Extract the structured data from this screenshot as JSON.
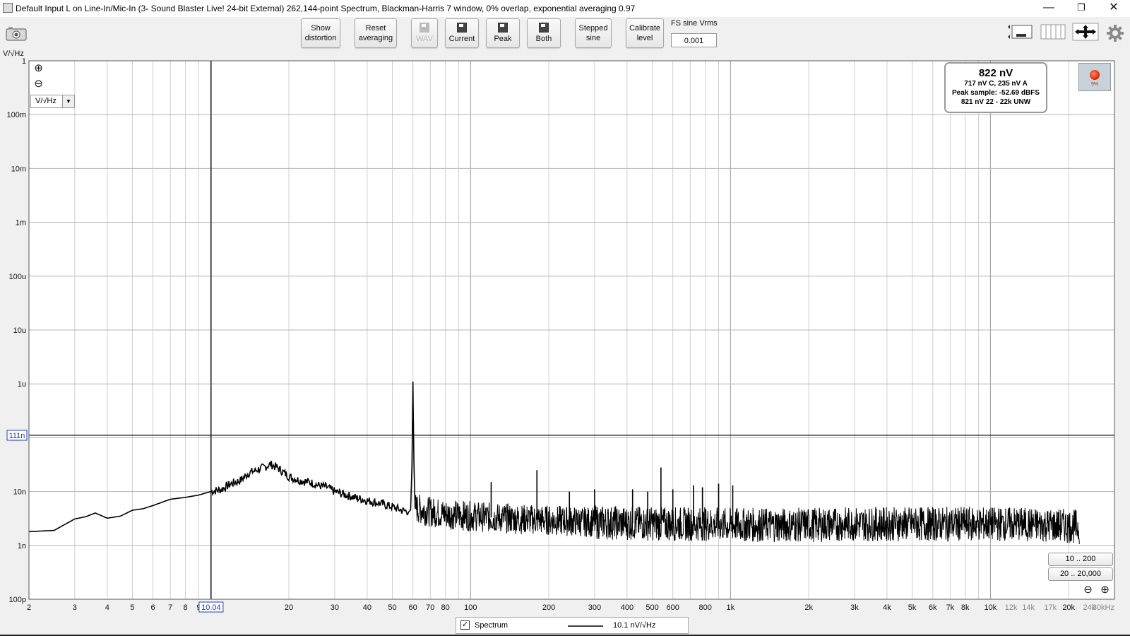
{
  "window": {
    "title": "Default Input L on Line-In/Mic-In (3- Sound Blaster Live! 24-bit External) 262,144-point Spectrum, Blackman-Harris 7 window, 0% overlap, exponential averaging 0.97",
    "minimize": "—",
    "restore": "❐",
    "close": "✕"
  },
  "toolbar": {
    "show_distortion_1": "Show",
    "show_distortion_2": "distortion",
    "reset_averaging_1": "Reset",
    "reset_averaging_2": "averaging",
    "wav": "WAV",
    "current": "Current",
    "peak": "Peak",
    "both": "Both",
    "stepped_sine_1": "Stepped",
    "stepped_sine_2": "sine",
    "calibrate_level_1": "Calibrate",
    "calibrate_level_2": "level",
    "fs_label": "FS sine Vrms",
    "fs_value": "0.001",
    "icons": [
      "camera-icon",
      "view-layout-icon",
      "columns-icon",
      "fit-arrows-icon",
      "gear-icon"
    ]
  },
  "readout": {
    "main": "822 nV",
    "line1": "717 nV C, 235 nV A",
    "line2": "Peak sample: -52.69 dBFS",
    "line3": "821 nV 22 - 22k UNW"
  },
  "record_button": {
    "percent": "9%",
    "color": "#e03010"
  },
  "unit_select": {
    "value": "V/√Hz"
  },
  "range_buttons": {
    "r1": "10 .. 200",
    "r2": "20 .. 20,000"
  },
  "legend": {
    "checked": true,
    "check_mark": "✓",
    "label": "Spectrum",
    "value": "10.1 nV/√Hz"
  },
  "cursor": {
    "x_label": "10.04",
    "y_label": "111n"
  },
  "chart_data": {
    "type": "line",
    "ylabel": "V/√Hz",
    "xlabel_unit": "kHz",
    "x_scale": "log",
    "y_scale": "log",
    "xlim": [
      2,
      30000
    ],
    "ylim": [
      1e-10,
      1
    ],
    "grid": true,
    "y_ticks": [
      {
        "v": 1,
        "t": "1"
      },
      {
        "v": 0.1,
        "t": "100m"
      },
      {
        "v": 0.01,
        "t": "10m"
      },
      {
        "v": 0.001,
        "t": "1m"
      },
      {
        "v": 0.0001,
        "t": "100u"
      },
      {
        "v": 1e-05,
        "t": "10u"
      },
      {
        "v": 1e-06,
        "t": "1u"
      },
      {
        "v": 1e-07,
        "t": "111n"
      },
      {
        "v": 1e-08,
        "t": "10n"
      },
      {
        "v": 1e-09,
        "t": "1n"
      },
      {
        "v": 1e-10,
        "t": "100p"
      }
    ],
    "x_ticks": [
      {
        "v": 2,
        "t": "2"
      },
      {
        "v": 3,
        "t": "3"
      },
      {
        "v": 4,
        "t": "4"
      },
      {
        "v": 5,
        "t": "5"
      },
      {
        "v": 6,
        "t": "6"
      },
      {
        "v": 7,
        "t": "7"
      },
      {
        "v": 8,
        "t": "8"
      },
      {
        "v": 9,
        "t": "9"
      },
      {
        "v": 20,
        "t": "20"
      },
      {
        "v": 30,
        "t": "30"
      },
      {
        "v": 40,
        "t": "40"
      },
      {
        "v": 50,
        "t": "50"
      },
      {
        "v": 60,
        "t": "60"
      },
      {
        "v": 70,
        "t": "70"
      },
      {
        "v": 80,
        "t": "80"
      },
      {
        "v": 100,
        "t": "100"
      },
      {
        "v": 200,
        "t": "200"
      },
      {
        "v": 300,
        "t": "300"
      },
      {
        "v": 400,
        "t": "400"
      },
      {
        "v": 500,
        "t": "500"
      },
      {
        "v": 600,
        "t": "600"
      },
      {
        "v": 800,
        "t": "800"
      },
      {
        "v": 1000,
        "t": "1k"
      },
      {
        "v": 2000,
        "t": "2k"
      },
      {
        "v": 3000,
        "t": "3k"
      },
      {
        "v": 4000,
        "t": "4k"
      },
      {
        "v": 5000,
        "t": "5k"
      },
      {
        "v": 6000,
        "t": "6k"
      },
      {
        "v": 7000,
        "t": "7k"
      },
      {
        "v": 8000,
        "t": "8k"
      },
      {
        "v": 10000,
        "t": "10k"
      },
      {
        "v": 12000,
        "t": "12k"
      },
      {
        "v": 14000,
        "t": "14k"
      },
      {
        "v": 17000,
        "t": "17k"
      },
      {
        "v": 20000,
        "t": "20k"
      },
      {
        "v": 24000,
        "t": "24k"
      },
      {
        "v": 30000,
        "t": "30kHz"
      }
    ],
    "series": [
      {
        "name": "Spectrum",
        "color": "#000000",
        "x": [
          2,
          2.5,
          3,
          3.3,
          3.6,
          4,
          4.5,
          5,
          5.5,
          6,
          7,
          8,
          9,
          10,
          11,
          12,
          13,
          14,
          15,
          16,
          17,
          18,
          19,
          20,
          22,
          24,
          26,
          28,
          30,
          35,
          40,
          45,
          50,
          55,
          58,
          59,
          59.7,
          60,
          60.3,
          61,
          65,
          70,
          80,
          100,
          120,
          150,
          180,
          250,
          300,
          400,
          600,
          800,
          1000,
          1500,
          2000,
          3000,
          5000,
          8000,
          12000,
          16000,
          20000,
          22000
        ],
        "y": [
          1.8e-09,
          1.9e-09,
          3.1e-09,
          3.4e-09,
          4e-09,
          3.2e-09,
          3.5e-09,
          4.5e-09,
          4.8e-09,
          5.5e-09,
          7.2e-09,
          7.8e-09,
          8.6e-09,
          1e-08,
          1.1e-08,
          1.4e-08,
          1.6e-08,
          2.2e-08,
          2.5e-08,
          2.8e-08,
          3.2e-08,
          2.8e-08,
          2.3e-08,
          1.9e-08,
          1.6e-08,
          1.5e-08,
          1.3e-08,
          1.2e-08,
          1e-08,
          8e-09,
          6.8e-09,
          6e-09,
          5.2e-09,
          4.4e-09,
          4.3e-09,
          5e-09,
          2e-07,
          1.1e-06,
          1.5e-07,
          5e-09,
          4.6e-09,
          4.2e-09,
          3.8e-09,
          3.5e-09,
          3.3e-09,
          3.1e-09,
          3e-09,
          2.8e-09,
          2.7e-09,
          2.6e-09,
          2.5e-09,
          2.5e-09,
          2.4e-09,
          2.4e-09,
          2.4e-09,
          2.5e-09,
          2.5e-09,
          2.5e-09,
          2.5e-09,
          2.4e-09,
          2.3e-09,
          2.2e-09
        ]
      }
    ],
    "peaks": [
      {
        "x": 120,
        "y": 1.5e-08
      },
      {
        "x": 180,
        "y": 2.5e-08
      },
      {
        "x": 240,
        "y": 1e-08
      },
      {
        "x": 300,
        "y": 1.1e-08
      },
      {
        "x": 420,
        "y": 1.1e-08
      },
      {
        "x": 480,
        "y": 1e-08
      },
      {
        "x": 540,
        "y": 2.8e-08
      },
      {
        "x": 600,
        "y": 1.1e-08
      },
      {
        "x": 720,
        "y": 1.3e-08
      },
      {
        "x": 780,
        "y": 1.2e-08
      },
      {
        "x": 900,
        "y": 1.4e-08
      },
      {
        "x": 1020,
        "y": 1.3e-08
      }
    ]
  }
}
